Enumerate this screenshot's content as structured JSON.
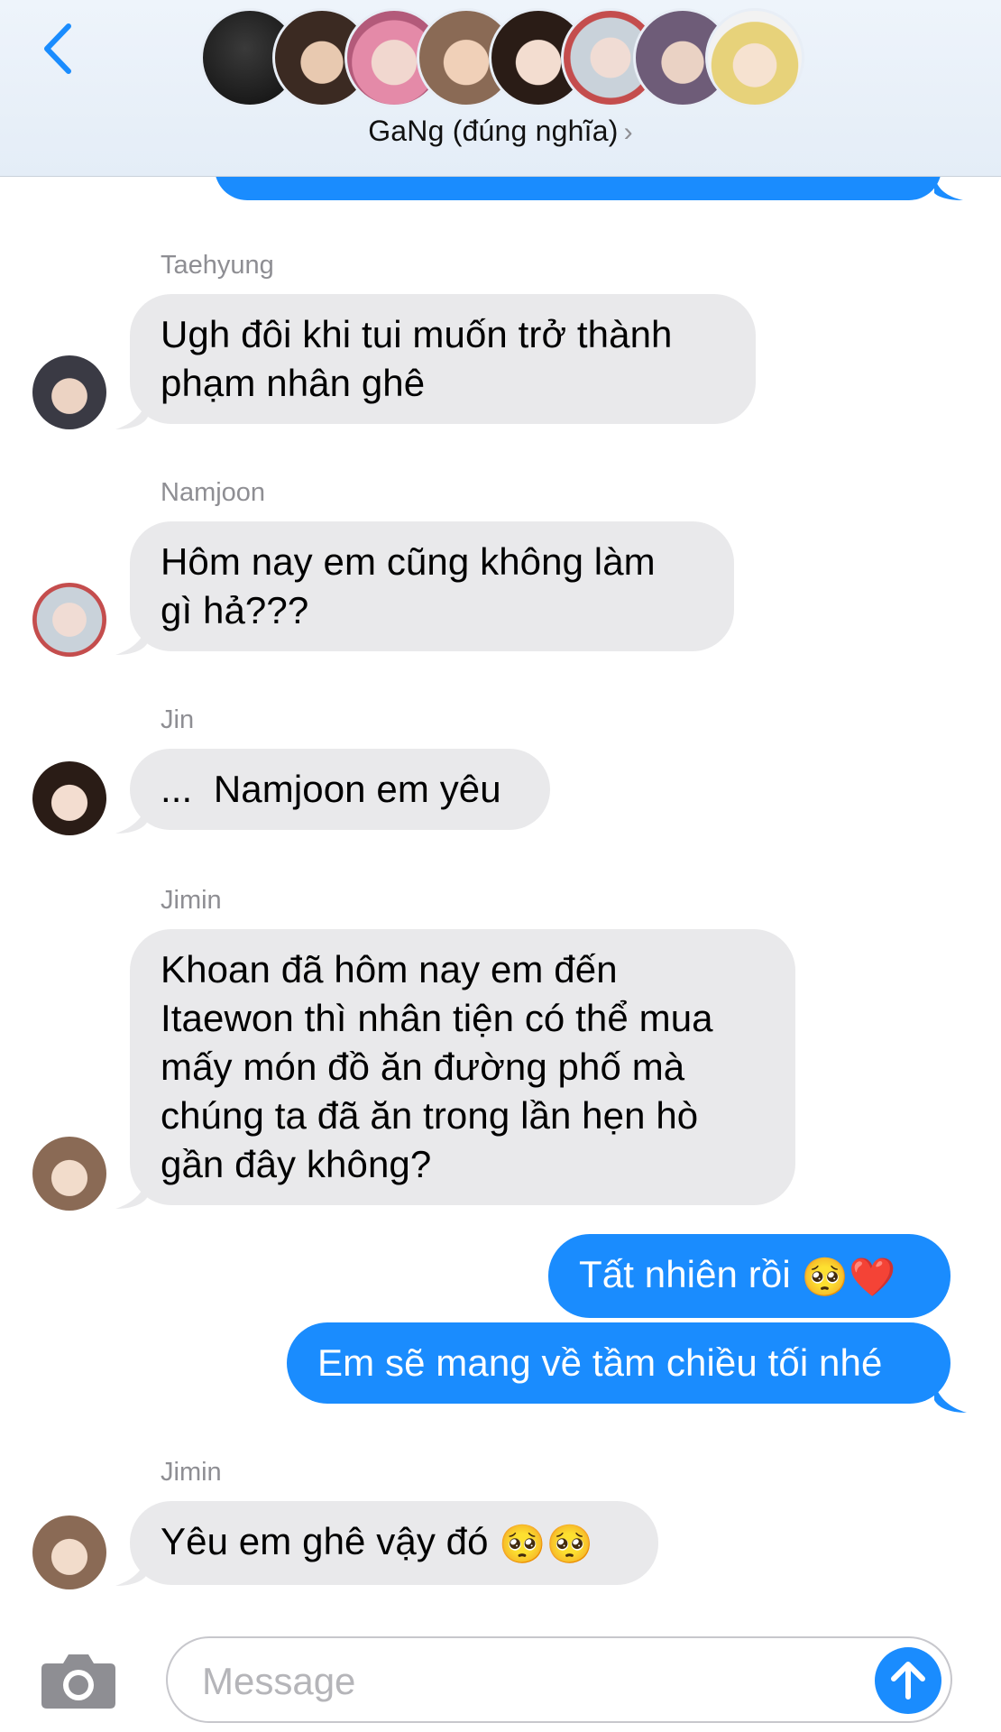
{
  "header": {
    "back_icon": "chevron-left-icon",
    "group_name": "GaNg (đúng nghĩa)",
    "chevron": "›",
    "member_avatars": [
      "member-1",
      "member-2",
      "member-3",
      "member-4",
      "member-5",
      "member-6",
      "member-7",
      "member-8"
    ]
  },
  "messages": [
    {
      "sender": "Taehyung",
      "direction": "incoming",
      "lines": [
        "Ugh đôi khi tui muốn trở thành",
        "phạm nhân ghê"
      ]
    },
    {
      "sender": "Namjoon",
      "direction": "incoming",
      "lines": [
        "Hôm nay em cũng không làm",
        "gì hả???"
      ]
    },
    {
      "sender": "Jin",
      "direction": "incoming",
      "lines": [
        "...  Namjoon em yêu"
      ]
    },
    {
      "sender": "Jimin",
      "direction": "incoming",
      "lines": [
        "Khoan đã hôm nay em đến",
        "Itaewon thì nhân tiện có thể mua",
        "mấy món đồ ăn đường phố mà",
        "chúng ta đã ăn trong lần hẹn hò",
        "gần đây không?"
      ]
    },
    {
      "sender": "",
      "direction": "outgoing",
      "text": "Tất nhiên rồi",
      "emojis": [
        "🥺",
        "❤️"
      ]
    },
    {
      "sender": "",
      "direction": "outgoing",
      "text": "Em sẽ mang về tầm chiều tối nhé"
    },
    {
      "sender": "Jimin",
      "direction": "incoming",
      "text": "Yêu em ghê vậy đó",
      "emojis": [
        "🥺",
        "🥺"
      ]
    }
  ],
  "composer": {
    "camera_icon": "camera-icon",
    "placeholder": "Message",
    "value": "",
    "send_icon": "arrow-up-icon"
  },
  "colors": {
    "accent": "#1a8cfe",
    "incoming_bubble": "#e9e9eb",
    "sender_label": "#8e8e93"
  }
}
